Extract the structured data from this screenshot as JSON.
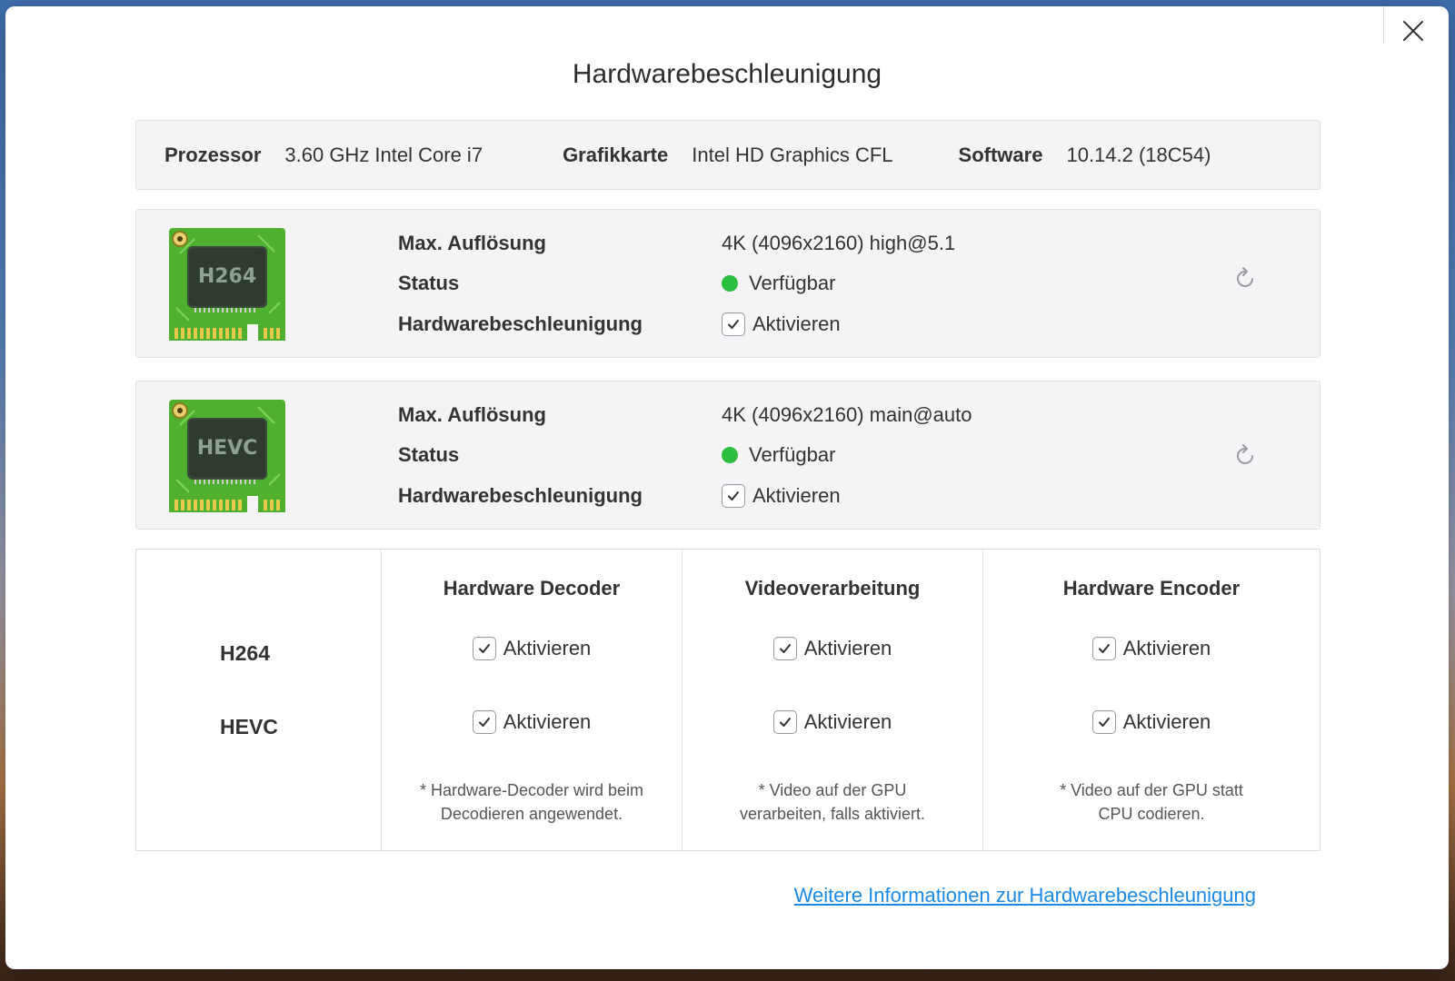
{
  "dialog": {
    "title": "Hardwarebeschleunigung",
    "close_icon": "close-icon"
  },
  "system": {
    "processor_label": "Prozessor",
    "processor_value": "3.60 GHz Intel Core i7",
    "gpu_label": "Grafikkarte",
    "gpu_value": "Intel HD Graphics CFL",
    "software_label": "Software",
    "software_value": "10.14.2 (18C54)"
  },
  "codecs": [
    {
      "chip_label": "H264",
      "max_res_label": "Max. Auflösung",
      "max_res_value": "4K (4096x2160) high@5.1",
      "status_label": "Status",
      "status_value": "Verfügbar",
      "status_color": "#2dbd3f",
      "hw_label": "Hardwarebeschleunigung",
      "hw_checkbox_label": "Aktivieren",
      "hw_checked": true
    },
    {
      "chip_label": "HEVC",
      "max_res_label": "Max. Auflösung",
      "max_res_value": "4K (4096x2160) main@auto",
      "status_label": "Status",
      "status_value": "Verfügbar",
      "status_color": "#2dbd3f",
      "hw_label": "Hardwarebeschleunigung",
      "hw_checkbox_label": "Aktivieren",
      "hw_checked": true
    }
  ],
  "matrix": {
    "rows": [
      "H264",
      "HEVC"
    ],
    "columns": [
      {
        "header": "Hardware Decoder",
        "options": [
          "Aktivieren",
          "Aktivieren"
        ],
        "note_line1": "* Hardware-Decoder wird beim",
        "note_line2": "Decodieren angewendet."
      },
      {
        "header": "Videoverarbeitung",
        "options": [
          "Aktivieren",
          "Aktivieren"
        ],
        "note_line1": "* Video auf der GPU",
        "note_line2": "verarbeiten, falls aktiviert."
      },
      {
        "header": "Hardware Encoder",
        "options": [
          "Aktivieren",
          "Aktivieren"
        ],
        "note_line1": "* Video auf der GPU statt",
        "note_line2": "CPU codieren."
      }
    ]
  },
  "footer": {
    "link_text": "Weitere Informationen zur Hardwarebeschleunigung"
  },
  "colors": {
    "link": "#1a8ae6",
    "chip_green": "#4fb02f",
    "status_green": "#2dbd3f"
  }
}
